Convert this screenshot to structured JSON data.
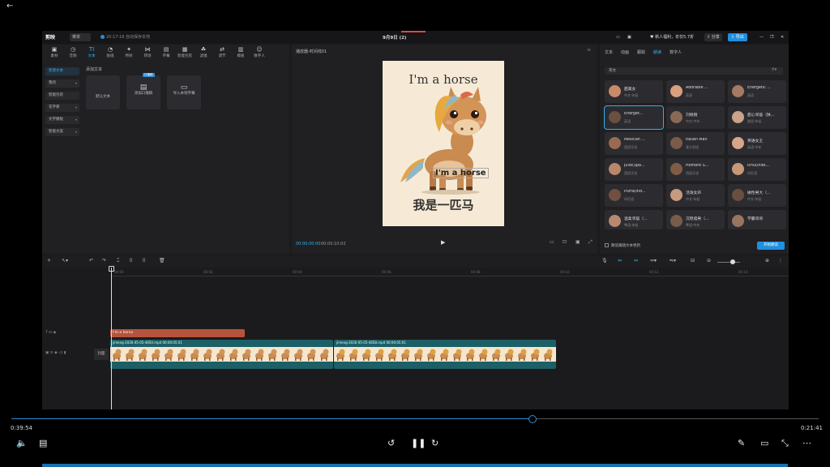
{
  "app": {
    "logo": "剪映",
    "menu_label": "菜单",
    "autosave": "20:17:18 自动保存本地",
    "doc_title": "9月9日 (2)",
    "promo": "新人福利，年仅5.7折",
    "share": "分享",
    "export": "导出"
  },
  "tools": [
    {
      "label": "素材",
      "icon": "media-icon"
    },
    {
      "label": "音频",
      "icon": "audio-icon"
    },
    {
      "label": "文本",
      "icon": "text-icon",
      "active": true
    },
    {
      "label": "贴纸",
      "icon": "sticker-icon"
    },
    {
      "label": "特效",
      "icon": "effects-icon"
    },
    {
      "label": "转场",
      "icon": "transition-icon"
    },
    {
      "label": "字幕",
      "icon": "subtitle-icon"
    },
    {
      "label": "智能包装",
      "icon": "package-icon"
    },
    {
      "label": "滤镜",
      "icon": "filter-icon"
    },
    {
      "label": "调节",
      "icon": "adjust-icon"
    },
    {
      "label": "模板",
      "icon": "template-icon"
    },
    {
      "label": "数字人",
      "icon": "digital-human-icon"
    }
  ],
  "sidenav": [
    {
      "label": "新建文本",
      "active": true
    },
    {
      "label": "我的",
      "chev": true
    },
    {
      "label": "智能包装",
      "chev": false
    },
    {
      "label": "花字库",
      "chev": true
    },
    {
      "label": "文字模板",
      "chev": true
    },
    {
      "label": "智能文案",
      "chev": true
    }
  ],
  "text_panel": {
    "heading": "添加文本",
    "cards": [
      {
        "label": "默认文本",
        "icon": ""
      },
      {
        "label": "添加口播稿",
        "icon": "script-icon",
        "badge": "口播稿"
      },
      {
        "label": "导入本地字幕",
        "icon": "folder-icon"
      }
    ]
  },
  "player": {
    "title": "播放器-时间线01",
    "canvas_title": "I'm a horse",
    "canvas_cn": "我是一匹马",
    "overlay_text": "I'm a horse",
    "time_current": "00:00:00:00",
    "time_total": "00:00:10:02"
  },
  "right_panel": {
    "tabs": [
      {
        "label": "文本"
      },
      {
        "label": "动画"
      },
      {
        "label": "跟踪"
      },
      {
        "label": "朗读",
        "active": true
      },
      {
        "label": "数字人"
      }
    ],
    "lang": "英文",
    "voices": [
      {
        "name": "甜美女",
        "sub": "中文·年轻",
        "color": "#c98a6a"
      },
      {
        "name": "Adorable ...",
        "sub": "英语",
        "color": "#d9a07e"
      },
      {
        "name": "Energetic ...",
        "sub": "英语",
        "color": "#a57a62"
      },
      {
        "name": "Energet...",
        "sub": "英语",
        "color": "#6a5040",
        "selected": true
      },
      {
        "name": "刘德刚",
        "sub": "中文·中年",
        "color": "#8a6a55"
      },
      {
        "name": "甜心邻居（陕...",
        "sub": "陕西·年轻",
        "color": "#caa28a"
      },
      {
        "name": "Mexican ...",
        "sub": "西班牙语",
        "color": "#9a6a50"
      },
      {
        "name": "Italian Man",
        "sub": "意大利语",
        "color": "#7a5a48"
      },
      {
        "name": "英语女王",
        "sub": "英语·中年",
        "color": "#d7a58a"
      },
      {
        "name": "Julie(Spa...",
        "sub": "西班牙语",
        "color": "#b8876a"
      },
      {
        "name": "Hombre S...",
        "sub": "西班牙语",
        "color": "#7f5c46"
      },
      {
        "name": "Ichu(Indo...",
        "sub": "印尼语",
        "color": "#c69878"
      },
      {
        "name": "Putra(Ind...",
        "sub": "印尼语",
        "color": "#705040"
      },
      {
        "name": "活泼女声",
        "sub": "中文·年轻",
        "color": "#c89a80"
      },
      {
        "name": "磁性男大（...",
        "sub": "中文·年轻",
        "color": "#6a4e40"
      },
      {
        "name": "温柔邻居（...",
        "sub": "粤语·年轻",
        "color": "#b88870"
      },
      {
        "name": "沉稳痞男（...",
        "sub": "粤语·中年",
        "color": "#7a5a4a"
      },
      {
        "name": "学霸哥哥",
        "sub": "",
        "color": "#9a7460"
      }
    ],
    "checkbox_label": "朗读跟随文本更新",
    "read_button": "开始朗读"
  },
  "timeline": {
    "ruler": [
      "00:00",
      "00:02",
      "00:04",
      "00:06",
      "00:08",
      "00:10",
      "00:12",
      "00:14"
    ],
    "text_clip": "I'm a horse",
    "cover": "封面",
    "video_clips": [
      {
        "label": "jimeng-2026-05-05-4650.mp4  00:00:05:01"
      },
      {
        "label": "jimeng-2026-05-05-4658.mp4  00:00:05:01"
      }
    ]
  },
  "media_player": {
    "elapsed": "0:39:54",
    "total": "0:21:41",
    "progress": 0.646
  },
  "colors": {
    "accent": "#2fb2e8",
    "text_clip": "#b5533c",
    "video_clip": "#1d5f66",
    "export": "#1f8fe0"
  }
}
